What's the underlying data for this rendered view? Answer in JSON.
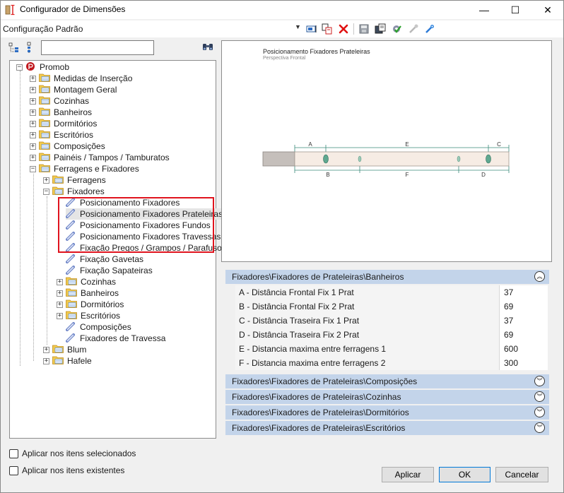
{
  "window": {
    "title": "Configurador de Dimensões",
    "min": "—",
    "max": "☐",
    "close": "✕"
  },
  "config": {
    "selected": "Configuração Padrão"
  },
  "search": {
    "value": "",
    "placeholder": ""
  },
  "tree": {
    "root": "Promob",
    "nodes": [
      "Medidas de Inserção",
      "Montagem Geral",
      "Cozinhas",
      "Banheiros",
      "Dormitórios",
      "Escritórios",
      "Composições",
      "Painéis / Tampos / Tamburatos",
      "Ferragens e Fixadores"
    ],
    "ferragens_children": [
      "Ferragens",
      "Fixadores"
    ],
    "fixadores_leaves": [
      "Posicionamento Fixadores",
      "Posicionamento Fixadores Prateleiras",
      "Posicionamento Fixadores Fundos",
      "Posicionamento Fixadores Travessas",
      "Fixação Pregos / Grampos / Parafusos",
      "Fixação Gavetas",
      "Fixação Sapateiras"
    ],
    "fixadores_folders": [
      "Cozinhas",
      "Banheiros",
      "Dormitórios",
      "Escritórios"
    ],
    "fixadores_tail_leaves": [
      "Composições",
      "Fixadores de Travessa"
    ],
    "other_groups": [
      "Blum",
      "Hafele"
    ]
  },
  "options": {
    "apply_selected": "Aplicar nos itens selecionados",
    "apply_existing": "Aplicar nos itens existentes"
  },
  "preview": {
    "title": "Posicionamento Fixadores Prateleiras",
    "subtitle": "Perspectiva Frontal",
    "labels_top": [
      "A",
      "E",
      "C"
    ],
    "labels_bottom": [
      "B",
      "F",
      "D"
    ]
  },
  "sections": [
    {
      "title": "Fixadores\\Fixadores de Prateleiras\\Banheiros",
      "expanded": true
    },
    {
      "title": "Fixadores\\Fixadores de Prateleiras\\Composições",
      "expanded": false
    },
    {
      "title": "Fixadores\\Fixadores de Prateleiras\\Cozinhas",
      "expanded": false
    },
    {
      "title": "Fixadores\\Fixadores de Prateleiras\\Dormitórios",
      "expanded": false
    },
    {
      "title": "Fixadores\\Fixadores de Prateleiras\\Escritórios",
      "expanded": false
    }
  ],
  "properties": [
    {
      "name": "A - Distância Frontal Fix 1 Prat",
      "value": "37"
    },
    {
      "name": "B - Distância Frontal Fix 2 Prat",
      "value": "69"
    },
    {
      "name": "C - Distância Traseira Fix 1 Prat",
      "value": "37"
    },
    {
      "name": "D - Distância Traseira Fix 2 Prat",
      "value": "69"
    },
    {
      "name": "E - Distancia maxima entre ferragens 1",
      "value": "600"
    },
    {
      "name": "F - Distancia maxima entre ferragens 2",
      "value": "300"
    }
  ],
  "buttons": {
    "apply": "Aplicar",
    "ok": "OK",
    "cancel": "Cancelar"
  },
  "colors": {
    "highlight": "#e0141e",
    "section_header": "#c3d4ea",
    "accent": "#0078d7",
    "dim_line": "#3a8a7a"
  }
}
